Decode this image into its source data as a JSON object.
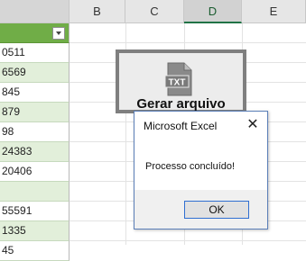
{
  "columns": [
    "",
    "B",
    "C",
    "D",
    "E"
  ],
  "selected_column": "D",
  "column_a_cells": [
    "",
    "0511",
    "6569",
    "845",
    "879",
    "98",
    "24383",
    "20406",
    "",
    "55591",
    "1335",
    "45"
  ],
  "shape_button": {
    "label": "Gerar arquivo",
    "icon": "txt-file-icon",
    "icon_text": "TXT"
  },
  "dialog": {
    "title": "Microsoft Excel",
    "message": "Processo concluído!",
    "ok_label": "OK",
    "close_glyph": "✕"
  },
  "colors": {
    "header_green": "#70ad47",
    "band_green": "#e2efda",
    "selected_header": "#217346"
  }
}
